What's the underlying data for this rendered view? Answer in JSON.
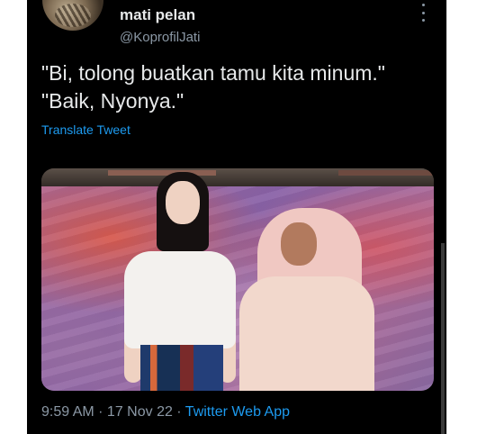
{
  "tweet": {
    "author_name": "mati pelan",
    "author_handle": "@KoprofilJati",
    "text": "\"Bi, tolong buatkan tamu kita minum.\"\n\"Baik, Nyonya.\"",
    "translate_label": "Translate Tweet",
    "time": "9:59 AM",
    "separator": " · ",
    "date": "17 Nov 22",
    "source_app": "Twitter Web App"
  },
  "icons": {
    "avatar": "avatar-image",
    "more": "more-options-icon"
  },
  "colors": {
    "background": "#000000",
    "primary_text": "#e7e9ea",
    "secondary_text": "#8b98a5",
    "link": "#1d9bf0"
  }
}
